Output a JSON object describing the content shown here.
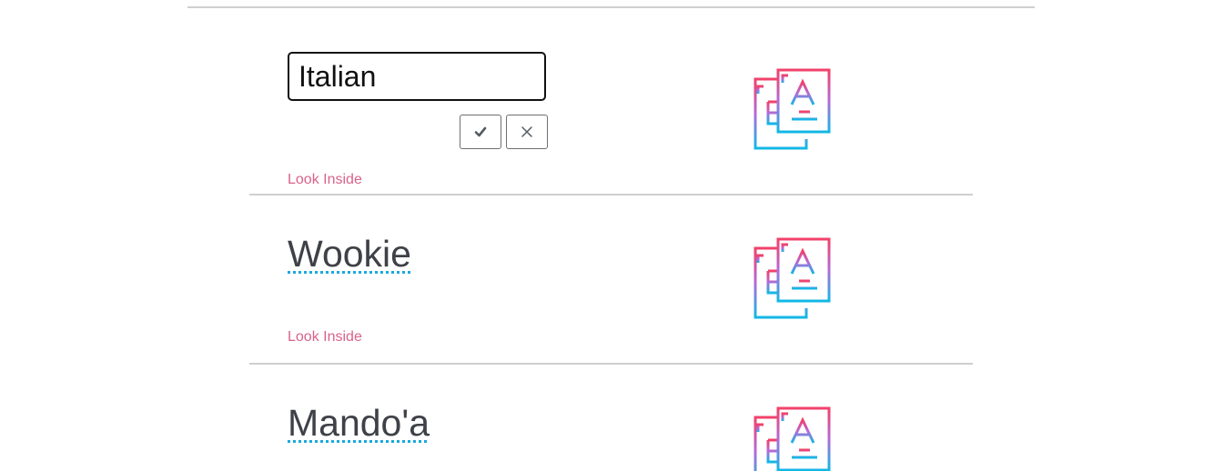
{
  "editing_row": {
    "input_value": "Italian",
    "confirm_icon": "check-icon",
    "cancel_icon": "close-icon",
    "link_label": "Look Inside",
    "icon": "language-documents-icon"
  },
  "rows": [
    {
      "title": "Wookie",
      "link_label": "Look Inside",
      "icon": "language-documents-icon"
    },
    {
      "title": "Mando'a",
      "icon": "language-documents-icon"
    }
  ],
  "colors": {
    "link": "#d9638a",
    "underline": "#1aa8e0",
    "title_text": "#3e4147",
    "divider": "#cfcfcf",
    "icon_gradient_top": "#f2416a",
    "icon_gradient_bottom": "#12b8e5"
  }
}
